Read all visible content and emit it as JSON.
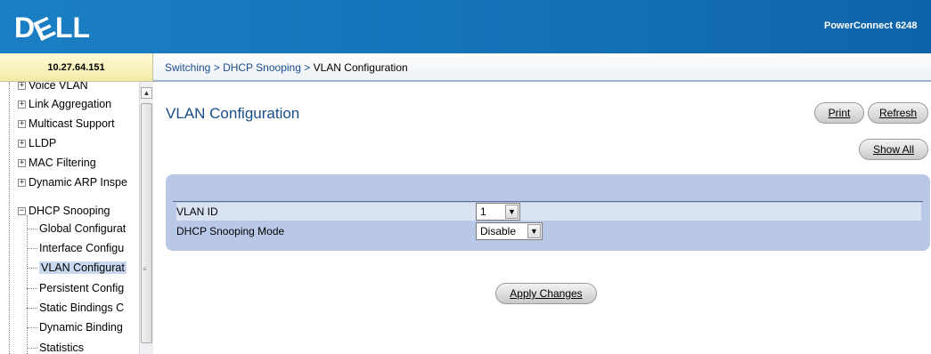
{
  "header": {
    "logo_text": "DELL",
    "product": "PowerConnect 6248"
  },
  "ip_address": "10.27.64.151",
  "breadcrumb": {
    "items": [
      "Switching",
      "DHCP Snooping",
      "VLAN Configuration"
    ],
    "separator": ">"
  },
  "sidebar": {
    "items": [
      {
        "label": "Voice VLAN",
        "expander": "+"
      },
      {
        "label": "Link Aggregation",
        "expander": "+"
      },
      {
        "label": "Multicast Support",
        "expander": "+"
      },
      {
        "label": "LLDP",
        "expander": "+"
      },
      {
        "label": "MAC Filtering",
        "expander": "+"
      },
      {
        "label": "Dynamic ARP Inspe",
        "expander": "+"
      },
      {
        "label": "DHCP Snooping",
        "expander": "−"
      },
      {
        "label": "Global Configurat"
      },
      {
        "label": "Interface Configu"
      },
      {
        "label": "VLAN Configurat",
        "selected": true
      },
      {
        "label": "Persistent Config"
      },
      {
        "label": "Static Bindings C"
      },
      {
        "label": "Dynamic Binding"
      },
      {
        "label": "Statistics"
      }
    ],
    "scroll_up_icon": "▲",
    "scroll_grip": "≡"
  },
  "main": {
    "title": "VLAN Configuration",
    "buttons": {
      "print": "Print",
      "refresh": "Refresh",
      "show_all": "Show All",
      "apply": "Apply Changes"
    },
    "fields": {
      "vlan_id": {
        "label": "VLAN ID",
        "value": "1"
      },
      "mode": {
        "label": "DHCP Snooping Mode",
        "value": "Disable"
      }
    },
    "dropdown_arrow": "▼"
  },
  "colors": {
    "header_blue": "#1572b7",
    "title_blue": "#1a4d8c",
    "panel": "#b9c8e6",
    "ip_bar": "#f4eaa8"
  }
}
